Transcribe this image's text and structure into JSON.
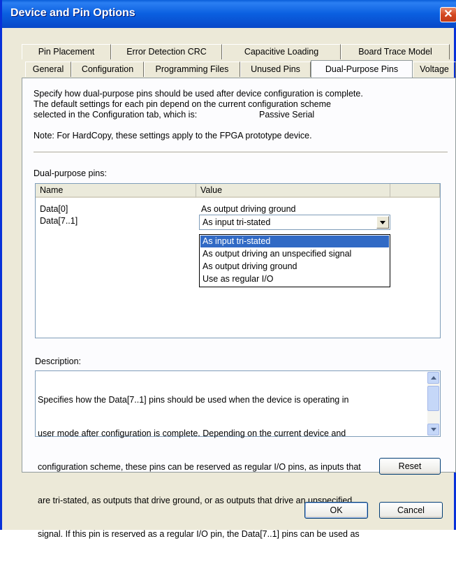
{
  "window": {
    "title": "Device and Pin Options",
    "close_glyph": "✕"
  },
  "tabs": {
    "row1": [
      "Pin Placement",
      "Error Detection CRC",
      "Capacitive Loading",
      "Board Trace Model"
    ],
    "row2": [
      "General",
      "Configuration",
      "Programming Files",
      "Unused Pins",
      "Dual-Purpose Pins",
      "Voltage"
    ],
    "active": "Dual-Purpose Pins"
  },
  "intro": {
    "line1": "Specify how dual-purpose pins should be used after device configuration is complete.",
    "line2": "The default settings for each pin depend on the current configuration scheme",
    "line3": "selected in the Configuration tab, which is:",
    "scheme": "Passive Serial",
    "note": "Note: For HardCopy, these settings apply to the FPGA prototype device."
  },
  "pins": {
    "label": "Dual-purpose pins:",
    "columns": [
      "Name",
      "Value"
    ],
    "rows": [
      {
        "name": "Data[0]",
        "value": "As output driving ground"
      },
      {
        "name": "Data[7..1]",
        "value": "As input tri-stated"
      }
    ]
  },
  "dropdown": {
    "selected": "As input tri-stated",
    "options": [
      "As input tri-stated",
      "As output driving an unspecified signal",
      "As output driving ground",
      "Use as regular I/O"
    ]
  },
  "description": {
    "label": "Description:",
    "lines": [
      "Specifies how the Data[7..1] pins should be used when the device is operating in",
      "user mode after configuration is complete. Depending on the current device and",
      "configuration scheme, these pins can be reserved as regular I/O pins, as inputs that",
      "are tri-stated, as outputs that drive ground, or as outputs that drive an unspecified",
      "signal. If this pin is reserved as a regular I/O pin, the Data[7..1] pins can be used as"
    ]
  },
  "buttons": {
    "reset": "Reset",
    "ok": "OK",
    "cancel": "Cancel"
  },
  "icons": {
    "close": "close-icon",
    "combo_arrow": "chevron-down-icon",
    "scroll_up": "scroll-up-icon",
    "scroll_down": "scroll-down-icon"
  },
  "colors": {
    "titlebar": "#0a5fe0",
    "selection": "#316ac5",
    "dialog_bg": "#ece9d8"
  }
}
